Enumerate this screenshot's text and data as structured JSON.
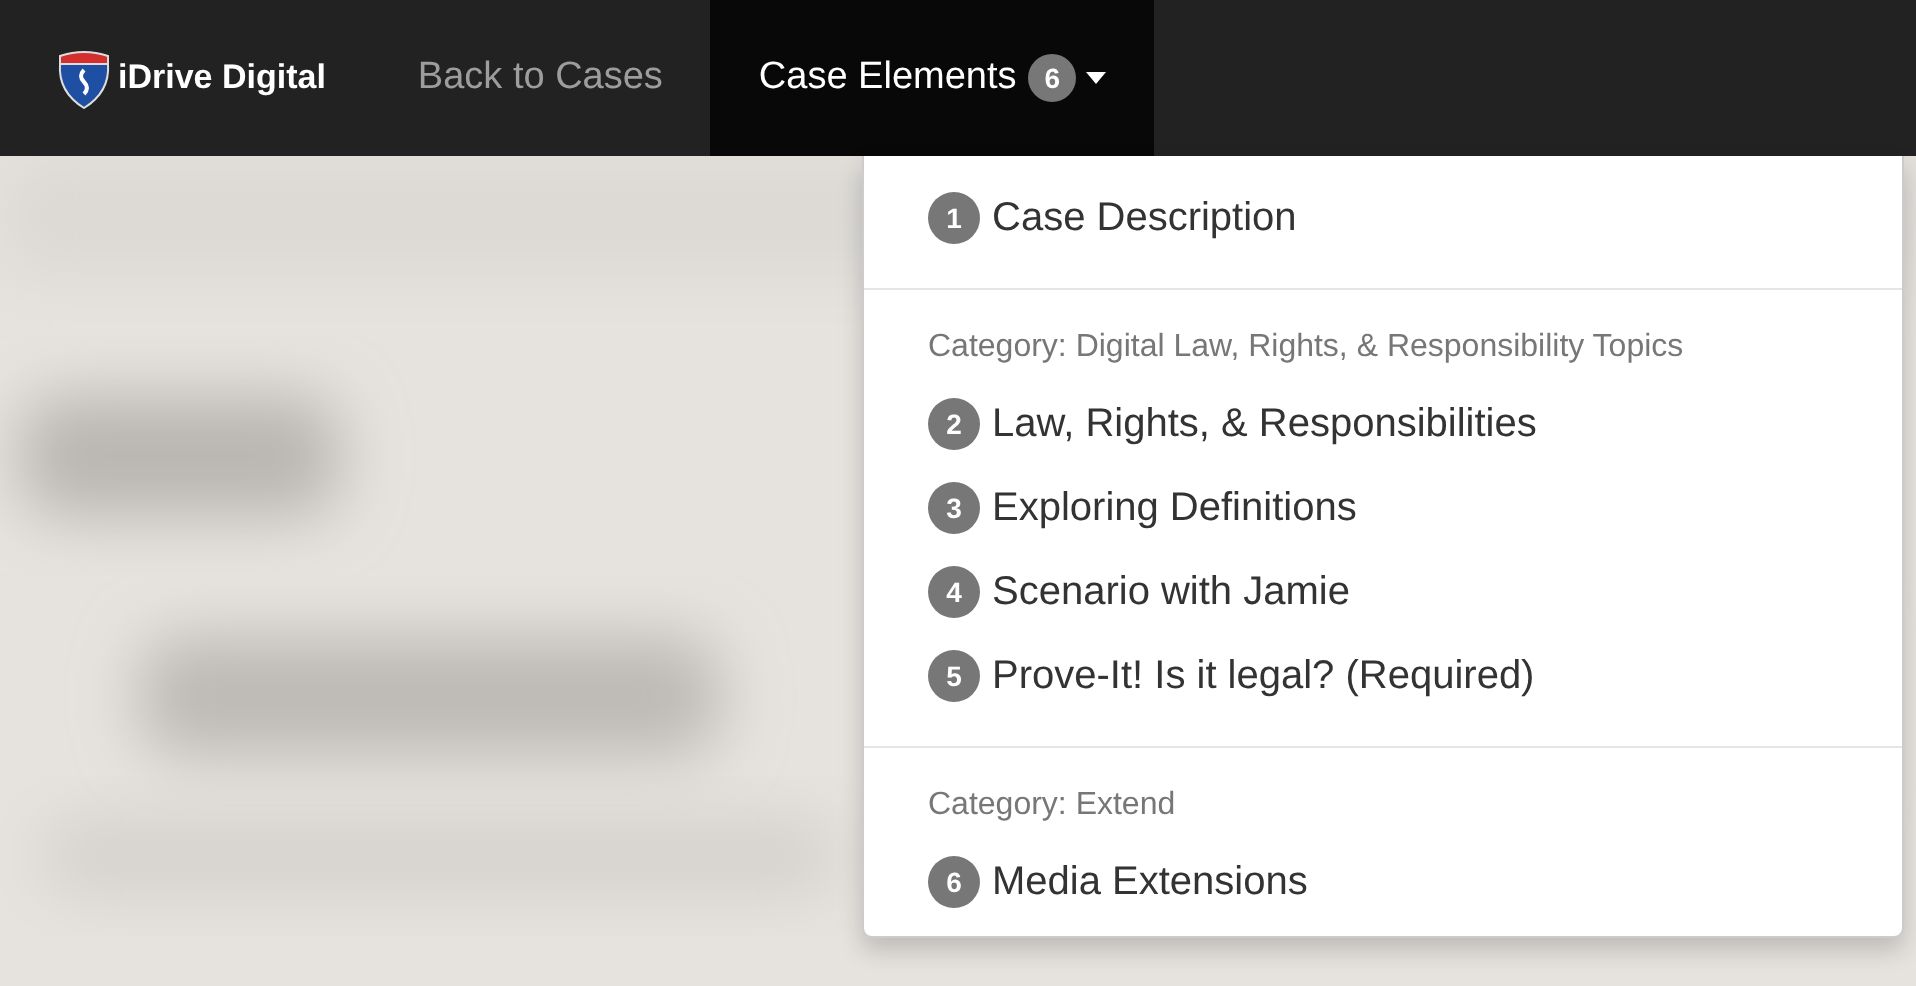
{
  "navbar": {
    "brand": "iDrive Digital",
    "links": [
      {
        "label": "Back to Cases",
        "selected": false
      },
      {
        "label": "Case Elements",
        "badge": "6",
        "selected": true,
        "expanded": true
      }
    ]
  },
  "dropdown": {
    "sections": [
      {
        "items": [
          {
            "number": "1",
            "label": "Case Description"
          }
        ]
      },
      {
        "header": "Category: Digital Law, Rights, & Responsibility Topics",
        "items": [
          {
            "number": "2",
            "label": "Law, Rights, & Responsibilities"
          },
          {
            "number": "3",
            "label": "Exploring Definitions"
          },
          {
            "number": "4",
            "label": "Scenario with Jamie"
          },
          {
            "number": "5",
            "label": "Prove-It! Is it legal? (Required)"
          }
        ]
      },
      {
        "header": "Category: Extend",
        "items": [
          {
            "number": "6",
            "label": "Media Extensions"
          }
        ]
      }
    ]
  }
}
